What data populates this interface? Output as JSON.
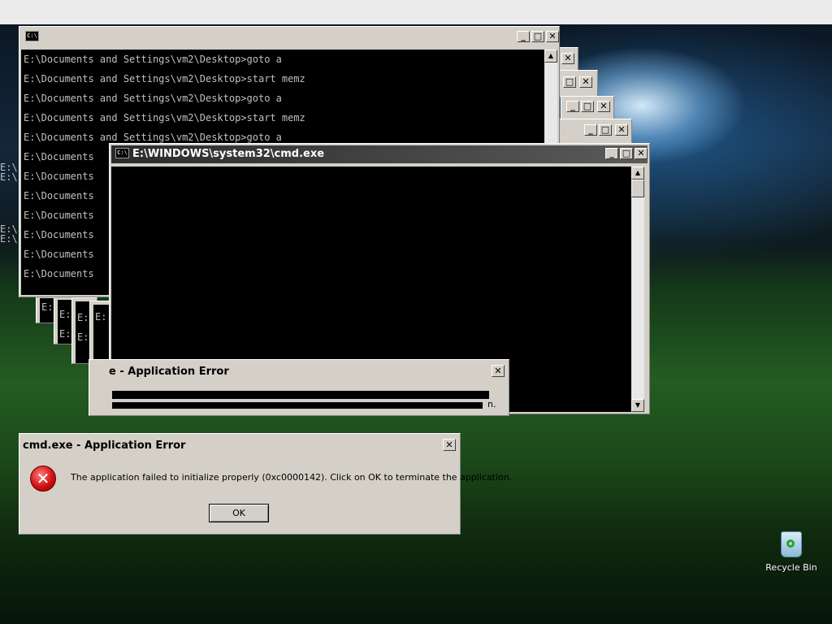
{
  "background_window": {
    "icon": "cmd-icon",
    "lines": [
      "E:\\Documents and Settings\\vm2\\Desktop>goto a",
      "E:\\Documents and Settings\\vm2\\Desktop>start memz",
      "E:\\Documents and Settings\\vm2\\Desktop>goto a",
      "E:\\Documents and Settings\\vm2\\Desktop>start memz",
      "E:\\Documents and Settings\\vm2\\Desktop>goto a",
      "E:\\Documents",
      "E:\\Documents",
      "E:\\Documents",
      "E:\\Documents",
      "E:\\Documents",
      "E:\\Documents",
      "E:\\Documents"
    ]
  },
  "cmd_window": {
    "title": "E:\\WINDOWS\\system32\\cmd.exe"
  },
  "partial_error": {
    "title": "e - Application Error",
    "fragment": "n."
  },
  "error_dialog": {
    "title": "cmd.exe - Application Error",
    "message": "The application failed to initialize properly (0xc0000142). Click on OK to terminate the application.",
    "ok_label": "OK"
  },
  "desktop": {
    "recycle_bin_label": "Recycle Bin"
  },
  "colors": {
    "console_bg": "#000000",
    "console_text": "#c0c0c0",
    "dialog_face": "#d4d0c8",
    "active_title": "#2b2b2b",
    "error_icon": "#d01010"
  }
}
